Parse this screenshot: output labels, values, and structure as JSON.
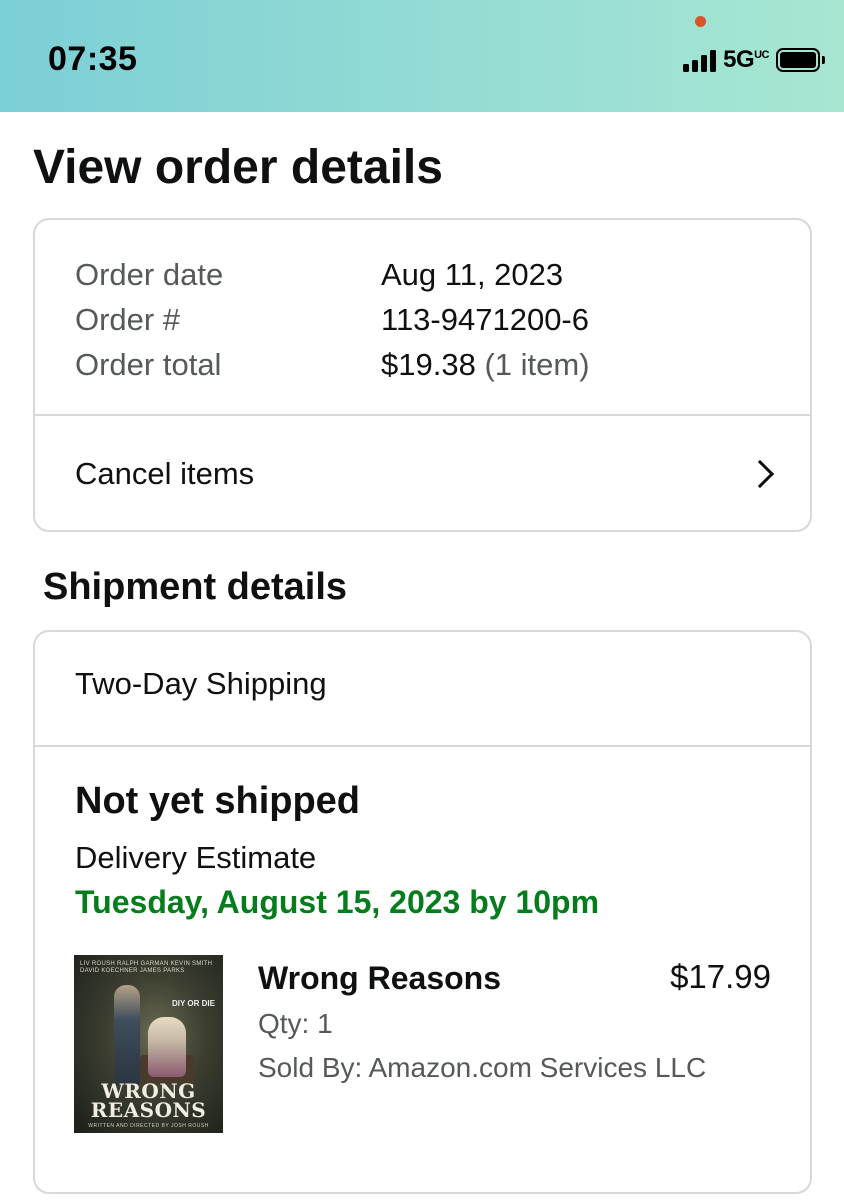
{
  "status_bar": {
    "time": "07:35",
    "network": "5G",
    "network_suffix": "UC",
    "signal_bars": 4,
    "battery_level": 1.0
  },
  "page": {
    "title": "View order details"
  },
  "order_summary": {
    "rows": [
      {
        "label": "Order date",
        "value": "Aug 11, 2023",
        "extra": ""
      },
      {
        "label": "Order #",
        "value": "113-9471200-6",
        "extra": ""
      },
      {
        "label": "Order total",
        "value": "$19.38",
        "extra": "(1 item)"
      }
    ],
    "cancel_label": "Cancel items",
    "cancel_icon": "chevron-right-icon"
  },
  "shipment": {
    "section_title": "Shipment details",
    "method": "Two-Day Shipping",
    "status": "Not yet shipped",
    "estimate_label": "Delivery Estimate",
    "estimate_date": "Tuesday, August 15, 2023 by 10pm",
    "estimate_color": "#067d1c",
    "item": {
      "name": "Wrong Reasons",
      "price": "$17.99",
      "qty": "Qty: 1",
      "sold_by": "Sold By: Amazon.com Services LLC",
      "poster": {
        "credits": "LIV ROUSH  RALPH GARMAN  KEVIN SMITH  DAVID KOECHNER  JAMES PARKS",
        "tag": "DIY OR DIE",
        "title_line1": "WRONG",
        "title_line2": "REASONS",
        "director": "WRITTEN AND DIRECTED BY JOSH ROUSH"
      }
    }
  }
}
